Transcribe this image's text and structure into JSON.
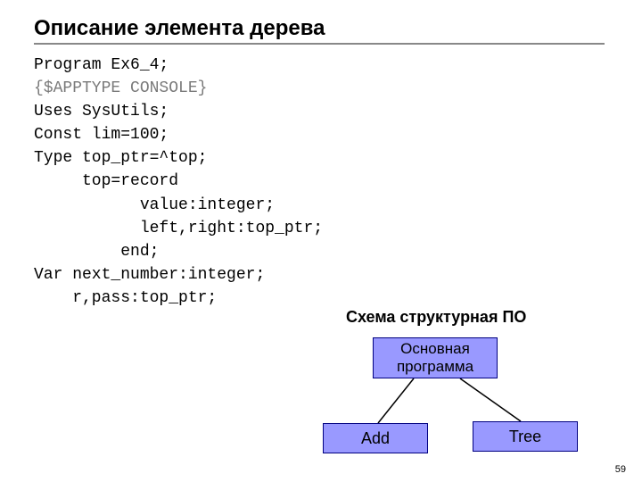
{
  "title": "Описание элемента дерева",
  "code": {
    "l1": "Program Ex6_4;",
    "l2": "{$APPTYPE CONSOLE}",
    "l3": "Uses SysUtils;",
    "l4": "Const lim=100;",
    "l5": "Type top_ptr=^top;",
    "l6": "     top=record",
    "l7": "           value:integer;",
    "l8": "           left,right:top_ptr;",
    "l9": "         end;",
    "l10": "Var next_number:integer;",
    "l11": "    r,pass:top_ptr;"
  },
  "diagram": {
    "title": "Схема структурная ПО",
    "main": "Основная\nпрограмма",
    "add": "Add",
    "tree": "Tree"
  },
  "page": "59"
}
